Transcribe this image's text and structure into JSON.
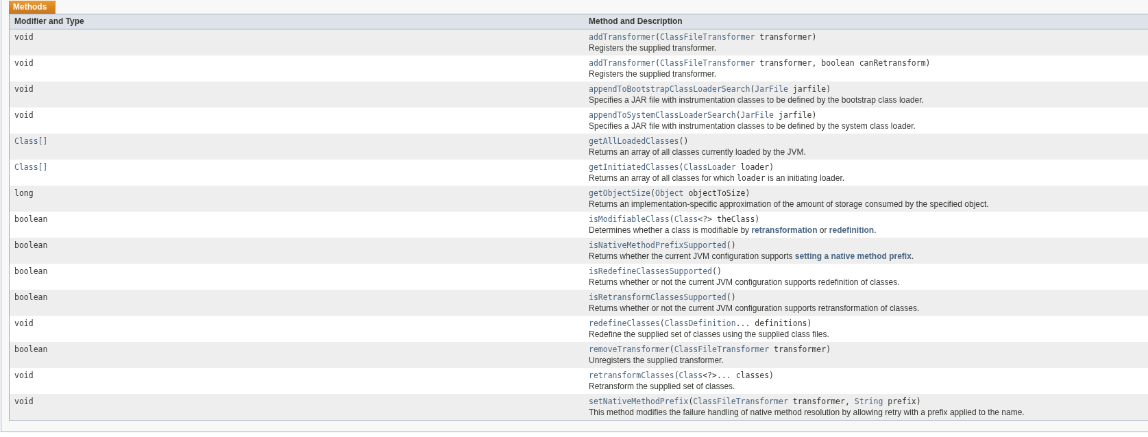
{
  "caption": "Methods",
  "columns": [
    "Modifier and Type",
    "Method and Description"
  ],
  "rows": [
    {
      "type": {
        "text": "void",
        "link": false
      },
      "signature": [
        {
          "kind": "link",
          "text": "addTransformer"
        },
        {
          "kind": "code",
          "text": "("
        },
        {
          "kind": "link",
          "text": "ClassFileTransformer"
        },
        {
          "kind": "code",
          "text": " transformer)"
        }
      ],
      "description": [
        {
          "kind": "text",
          "text": "Registers the supplied transformer."
        }
      ]
    },
    {
      "type": {
        "text": "void",
        "link": false
      },
      "signature": [
        {
          "kind": "link",
          "text": "addTransformer"
        },
        {
          "kind": "code",
          "text": "("
        },
        {
          "kind": "link",
          "text": "ClassFileTransformer"
        },
        {
          "kind": "code",
          "text": " transformer, boolean canRetransform)"
        }
      ],
      "description": [
        {
          "kind": "text",
          "text": "Registers the supplied transformer."
        }
      ]
    },
    {
      "type": {
        "text": "void",
        "link": false
      },
      "signature": [
        {
          "kind": "link",
          "text": "appendToBootstrapClassLoaderSearch"
        },
        {
          "kind": "code",
          "text": "("
        },
        {
          "kind": "link",
          "text": "JarFile"
        },
        {
          "kind": "code",
          "text": " jarfile)"
        }
      ],
      "description": [
        {
          "kind": "text",
          "text": "Specifies a JAR file with instrumentation classes to be defined by the bootstrap class loader."
        }
      ]
    },
    {
      "type": {
        "text": "void",
        "link": false
      },
      "signature": [
        {
          "kind": "link",
          "text": "appendToSystemClassLoaderSearch"
        },
        {
          "kind": "code",
          "text": "("
        },
        {
          "kind": "link",
          "text": "JarFile"
        },
        {
          "kind": "code",
          "text": " jarfile)"
        }
      ],
      "description": [
        {
          "kind": "text",
          "text": "Specifies a JAR file with instrumentation classes to be defined by the system class loader."
        }
      ]
    },
    {
      "type": {
        "text": "Class[]",
        "link": true
      },
      "signature": [
        {
          "kind": "link",
          "text": "getAllLoadedClasses"
        },
        {
          "kind": "code",
          "text": "()"
        }
      ],
      "description": [
        {
          "kind": "text",
          "text": "Returns an array of all classes currently loaded by the JVM."
        }
      ]
    },
    {
      "type": {
        "text": "Class[]",
        "link": true
      },
      "signature": [
        {
          "kind": "link",
          "text": "getInitiatedClasses"
        },
        {
          "kind": "code",
          "text": "("
        },
        {
          "kind": "link",
          "text": "ClassLoader"
        },
        {
          "kind": "code",
          "text": " loader)"
        }
      ],
      "description": [
        {
          "kind": "text",
          "text": "Returns an array of all classes for which "
        },
        {
          "kind": "code",
          "text": "loader"
        },
        {
          "kind": "text",
          "text": " is an initiating loader."
        }
      ]
    },
    {
      "type": {
        "text": "long",
        "link": false
      },
      "signature": [
        {
          "kind": "link",
          "text": "getObjectSize"
        },
        {
          "kind": "code",
          "text": "("
        },
        {
          "kind": "link",
          "text": "Object"
        },
        {
          "kind": "code",
          "text": " objectToSize)"
        }
      ],
      "description": [
        {
          "kind": "text",
          "text": "Returns an implementation-specific approximation of the amount of storage consumed by the specified object."
        }
      ]
    },
    {
      "type": {
        "text": "boolean",
        "link": false
      },
      "signature": [
        {
          "kind": "link",
          "text": "isModifiableClass"
        },
        {
          "kind": "code",
          "text": "("
        },
        {
          "kind": "link",
          "text": "Class"
        },
        {
          "kind": "code",
          "text": "<?> theClass)"
        }
      ],
      "description": [
        {
          "kind": "text",
          "text": "Determines whether a class is modifiable by "
        },
        {
          "kind": "link",
          "text": "retransformation"
        },
        {
          "kind": "text",
          "text": " or "
        },
        {
          "kind": "link",
          "text": "redefinition"
        },
        {
          "kind": "text",
          "text": "."
        }
      ]
    },
    {
      "type": {
        "text": "boolean",
        "link": false
      },
      "signature": [
        {
          "kind": "link",
          "text": "isNativeMethodPrefixSupported"
        },
        {
          "kind": "code",
          "text": "()"
        }
      ],
      "description": [
        {
          "kind": "text",
          "text": "Returns whether the current JVM configuration supports "
        },
        {
          "kind": "link",
          "text": "setting a native method prefix"
        },
        {
          "kind": "text",
          "text": "."
        }
      ]
    },
    {
      "type": {
        "text": "boolean",
        "link": false
      },
      "signature": [
        {
          "kind": "link",
          "text": "isRedefineClassesSupported"
        },
        {
          "kind": "code",
          "text": "()"
        }
      ],
      "description": [
        {
          "kind": "text",
          "text": "Returns whether or not the current JVM configuration supports redefinition of classes."
        }
      ]
    },
    {
      "type": {
        "text": "boolean",
        "link": false
      },
      "signature": [
        {
          "kind": "link",
          "text": "isRetransformClassesSupported"
        },
        {
          "kind": "code",
          "text": "()"
        }
      ],
      "description": [
        {
          "kind": "text",
          "text": "Returns whether or not the current JVM configuration supports retransformation of classes."
        }
      ]
    },
    {
      "type": {
        "text": "void",
        "link": false
      },
      "signature": [
        {
          "kind": "link",
          "text": "redefineClasses"
        },
        {
          "kind": "code",
          "text": "("
        },
        {
          "kind": "link",
          "text": "ClassDefinition"
        },
        {
          "kind": "code",
          "text": "... definitions)"
        }
      ],
      "description": [
        {
          "kind": "text",
          "text": "Redefine the supplied set of classes using the supplied class files."
        }
      ]
    },
    {
      "type": {
        "text": "boolean",
        "link": false
      },
      "signature": [
        {
          "kind": "link",
          "text": "removeTransformer"
        },
        {
          "kind": "code",
          "text": "("
        },
        {
          "kind": "link",
          "text": "ClassFileTransformer"
        },
        {
          "kind": "code",
          "text": " transformer)"
        }
      ],
      "description": [
        {
          "kind": "text",
          "text": "Unregisters the supplied transformer."
        }
      ]
    },
    {
      "type": {
        "text": "void",
        "link": false
      },
      "signature": [
        {
          "kind": "link",
          "text": "retransformClasses"
        },
        {
          "kind": "code",
          "text": "("
        },
        {
          "kind": "link",
          "text": "Class"
        },
        {
          "kind": "code",
          "text": "<?>... classes)"
        }
      ],
      "description": [
        {
          "kind": "text",
          "text": "Retransform the supplied set of classes."
        }
      ]
    },
    {
      "type": {
        "text": "void",
        "link": false
      },
      "signature": [
        {
          "kind": "link",
          "text": "setNativeMethodPrefix"
        },
        {
          "kind": "code",
          "text": "("
        },
        {
          "kind": "link",
          "text": "ClassFileTransformer"
        },
        {
          "kind": "code",
          "text": " transformer, "
        },
        {
          "kind": "link",
          "text": "String"
        },
        {
          "kind": "code",
          "text": " prefix)"
        }
      ],
      "description": [
        {
          "kind": "text",
          "text": "This method modifies the failure handling of native method resolution by allowing retry with a prefix applied to the name."
        }
      ]
    }
  ]
}
